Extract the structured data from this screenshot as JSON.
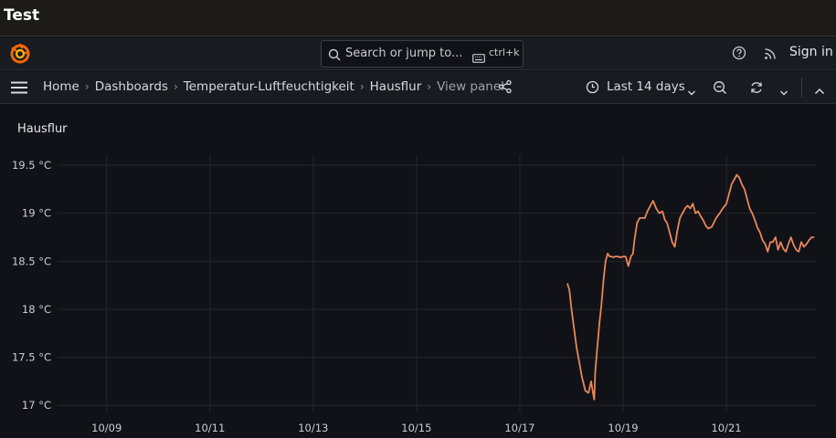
{
  "window": {
    "title": "Test"
  },
  "search": {
    "placeholder": "Search or jump to...",
    "shortcut": "ctrl+k"
  },
  "header": {
    "signin_label": "Sign in"
  },
  "breadcrumb": [
    "Home",
    "Dashboards",
    "Temperatur-Luftfeuchtigkeit",
    "Hausflur",
    "View panel"
  ],
  "toolbar": {
    "time_range": "Last 14 days"
  },
  "panel": {
    "title": "Hausflur"
  },
  "colors": {
    "series": "#e8875b",
    "background": "#111217",
    "grid": "#24262c"
  },
  "icons": [
    "grafana-logo-icon",
    "search-icon",
    "keyboard-icon",
    "help-icon",
    "rss-icon",
    "menu-icon",
    "share-icon",
    "clock-icon",
    "chevron-down-icon",
    "zoom-out-icon",
    "refresh-icon",
    "chevron-up-icon"
  ],
  "chart_data": {
    "type": "line",
    "title": "Hausflur",
    "xlabel": "",
    "ylabel": "",
    "x_ticks": [
      "10/09",
      "10/11",
      "10/13",
      "10/15",
      "10/17",
      "10/19",
      "10/21"
    ],
    "x_tick_days": [
      9,
      11,
      13,
      15,
      17,
      19,
      21
    ],
    "xlim": [
      8.05,
      22.75
    ],
    "y_ticks": [
      17,
      17.5,
      18,
      18.5,
      19,
      19.5
    ],
    "y_tick_labels": [
      "17 °C",
      "17.5 °C",
      "18 °C",
      "18.5 °C",
      "19 °C",
      "19.5 °C"
    ],
    "ylim": [
      16.85,
      19.7
    ],
    "unit": "°C",
    "grid": true,
    "legend": "none",
    "series": [
      {
        "x": [
          17.92,
          17.96,
          18.0,
          18.05,
          18.1,
          18.15,
          18.2,
          18.27,
          18.33,
          18.38,
          18.42,
          18.44,
          18.46,
          18.5,
          18.54,
          18.58,
          18.62,
          18.66,
          18.7,
          18.74,
          18.78,
          18.81,
          18.85,
          18.9,
          18.95,
          19.0,
          19.05,
          19.1,
          19.15,
          19.19,
          19.22,
          19.27,
          19.32,
          19.37,
          19.42,
          19.47,
          19.52,
          19.58,
          19.64,
          19.7,
          19.76,
          19.81,
          19.85,
          19.9,
          19.95,
          20.0,
          20.05,
          20.1,
          20.15,
          20.2,
          20.25,
          20.3,
          20.35,
          20.4,
          20.45,
          20.5,
          20.55,
          20.6,
          20.65,
          20.72,
          20.8,
          20.87,
          20.93,
          21.0,
          21.05,
          21.1,
          21.15,
          21.2,
          21.25,
          21.3,
          21.35,
          21.4,
          21.45,
          21.5,
          21.55,
          21.6,
          21.65,
          21.7,
          21.75,
          21.8,
          21.85,
          21.9,
          21.95,
          22.0,
          22.05,
          22.1,
          22.15,
          22.2,
          22.25,
          22.3,
          22.35,
          22.4,
          22.45,
          22.5,
          22.55,
          22.6,
          22.65,
          22.7
        ],
        "y": [
          18.27,
          18.2,
          18.0,
          17.8,
          17.6,
          17.45,
          17.3,
          17.15,
          17.13,
          17.25,
          17.12,
          17.06,
          17.35,
          17.6,
          17.85,
          18.05,
          18.3,
          18.5,
          18.58,
          18.55,
          18.55,
          18.54,
          18.55,
          18.55,
          18.54,
          18.55,
          18.55,
          18.45,
          18.55,
          18.58,
          18.72,
          18.9,
          18.95,
          18.95,
          18.95,
          19.02,
          19.07,
          19.13,
          19.05,
          19.0,
          19.02,
          18.93,
          18.9,
          18.8,
          18.7,
          18.65,
          18.82,
          18.95,
          19.0,
          19.05,
          19.08,
          19.05,
          19.1,
          19.0,
          19.02,
          18.97,
          18.93,
          18.87,
          18.84,
          18.86,
          18.95,
          19.0,
          19.05,
          19.1,
          19.2,
          19.3,
          19.35,
          19.4,
          19.37,
          19.3,
          19.25,
          19.15,
          19.05,
          19.0,
          18.93,
          18.85,
          18.8,
          18.72,
          18.68,
          18.6,
          18.7,
          18.7,
          18.75,
          18.62,
          18.7,
          18.63,
          18.6,
          18.68,
          18.75,
          18.67,
          18.62,
          18.6,
          18.7,
          18.65,
          18.68,
          18.72,
          18.75,
          18.75
        ]
      }
    ]
  }
}
